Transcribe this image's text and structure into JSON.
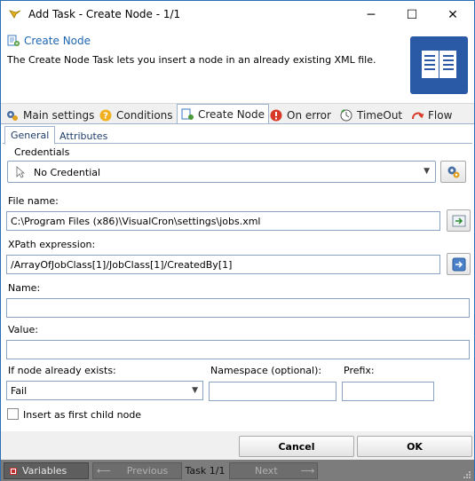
{
  "window": {
    "title": "Add Task - Create Node - 1/1",
    "minimize": "─",
    "maximize": "☐",
    "close": "✕"
  },
  "header": {
    "title": "Create Node",
    "description": "The Create Node Task lets you insert a node in an already existing XML file.",
    "icon": "book-icon"
  },
  "main_tabs": [
    {
      "label": "Main settings",
      "icon": "gears-icon"
    },
    {
      "label": "Conditions",
      "icon": "question-icon"
    },
    {
      "label": "Create Node",
      "icon": "create-node-icon",
      "active": true
    },
    {
      "label": "On error",
      "icon": "error-icon"
    },
    {
      "label": "TimeOut",
      "icon": "timeout-icon"
    },
    {
      "label": "Flow",
      "icon": "flow-icon"
    }
  ],
  "sub_tabs": [
    {
      "label": "General",
      "active": true
    },
    {
      "label": "Attributes"
    }
  ],
  "form": {
    "credentials_label": "Credentials",
    "credential_value": "No Credential",
    "file_name_label": "File name:",
    "file_name_value": "C:\\Program Files (x86)\\VisualCron\\settings\\jobs.xml",
    "xpath_label": "XPath expression:",
    "xpath_value": "/ArrayOfJobClass[1]/JobClass[1]/CreatedBy[1]",
    "name_label": "Name:",
    "name_value": "",
    "value_label": "Value:",
    "value_value": "",
    "exists_label": "If node already exists:",
    "exists_value": "Fail",
    "namespace_label": "Namespace (optional):",
    "namespace_value": "",
    "prefix_label": "Prefix:",
    "prefix_value": "",
    "first_child_label": "Insert as first child node",
    "first_child_checked": false
  },
  "buttons": {
    "cancel": "Cancel",
    "ok": "OK"
  },
  "statusbar": {
    "variables": "Variables",
    "previous": "Previous",
    "task": "Task 1/1",
    "next": "Next"
  },
  "colors": {
    "accent": "#1f66b0",
    "book_bg": "#2a59a6",
    "status_bar": "#7c7c7c"
  }
}
